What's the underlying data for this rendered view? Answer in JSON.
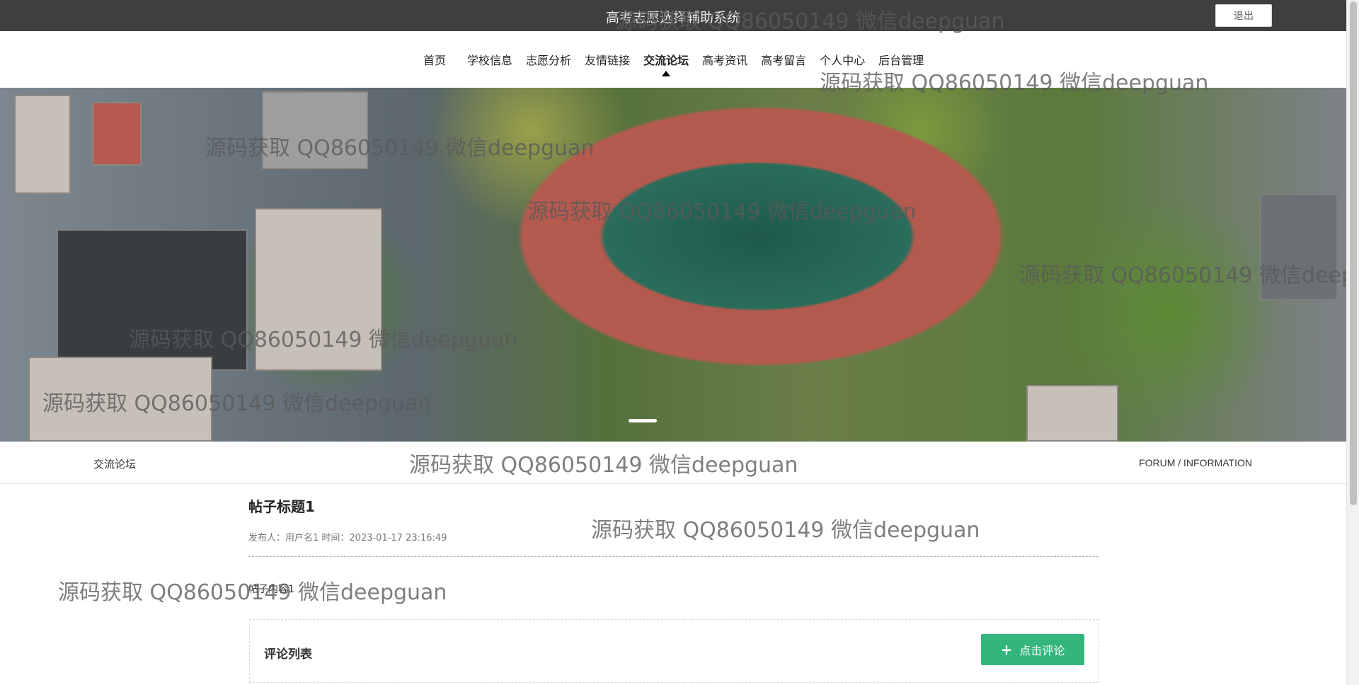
{
  "header": {
    "site_title": "高考志愿选择辅助系统",
    "logout_label": "退出"
  },
  "nav": {
    "items": [
      {
        "label": "首页"
      },
      {
        "label": "学校信息"
      },
      {
        "label": "志愿分析"
      },
      {
        "label": "友情链接"
      },
      {
        "label": "交流论坛",
        "active": true
      },
      {
        "label": "高考资讯"
      },
      {
        "label": "高考留言"
      },
      {
        "label": "个人中心"
      },
      {
        "label": "后台管理"
      }
    ]
  },
  "section": {
    "breadcrumb": "交流论坛",
    "subtitle": "FORUM / INFORMATION"
  },
  "post": {
    "title": "帖子标题1",
    "meta": "发布人：用户名1 时间：2023-01-17 23:16:49",
    "content": "帖子内容1"
  },
  "comments": {
    "heading": "评论列表",
    "add_button": "点击评论"
  },
  "watermark": {
    "text": "源码获取 QQ86050149 微信deepguan"
  },
  "colors": {
    "topbar": "#3f3f3f",
    "accent_green": "#34b57b"
  }
}
